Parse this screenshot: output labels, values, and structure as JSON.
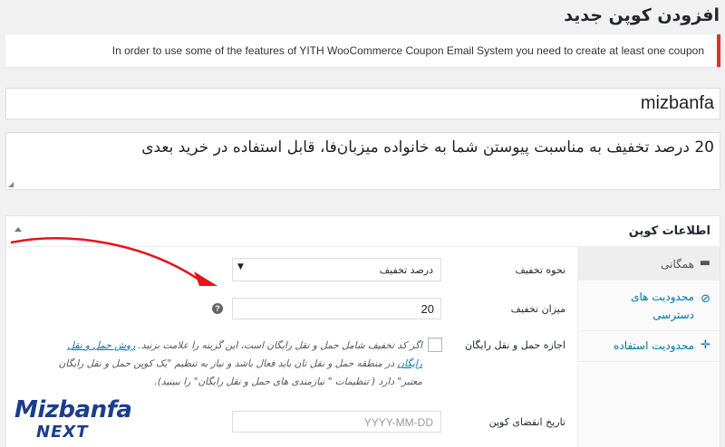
{
  "page_title": "افزودن کوپن جدید",
  "notice": {
    "text": "In order to use some of the features of YITH WooCommerce Coupon Email System you need to create at least one coupon",
    "border_color": "#dc3232"
  },
  "coupon_code": "mizbanfa",
  "description": "20 درصد تخفیف به مناسبت پیوستن شما به خانواده میزبان‌فا، قابل استفاده در خرید بعدی",
  "coupon_data": {
    "title": "اطلاعات کوپن",
    "tabs": [
      {
        "label": "همگانی",
        "icon": "ticket-icon",
        "active": true
      },
      {
        "label": "محدودیت های دسترسی",
        "icon": "restriction-icon",
        "active": false
      },
      {
        "label": "محدودیت استفاده",
        "icon": "plus-icon",
        "active": false
      }
    ],
    "fields": {
      "discount_type": {
        "label": "نحوه تخفیف",
        "value": "درصد تخفیف"
      },
      "amount": {
        "label": "میزان تخفیف",
        "value": "20",
        "help": "?"
      },
      "free_shipping": {
        "label": "اجازه حمل و نقل رایگان",
        "checked": false,
        "desc": "اگر کد تخفیف شامل حمل و نقل رایگان است، این گزینه را علامت بزنید.",
        "link_text": "روش حمل و نقل رایگان",
        "desc_after": "در منطقه حمل و نقل تان باید فعال باشد و نیاز به تنظیم \"یک کوپن حمل و نقل رایگان معتبر\" دارد ( تنظیمات \" نیازمندی های حمل و نقل رایگان\" را ببینید)."
      },
      "expiry_date": {
        "label": "تاریخ انقضای کوپن",
        "placeholder": "YYYY-MM-DD"
      }
    }
  },
  "logo": {
    "top": "Mizbanfa",
    "bottom": "NEXT",
    "color": "#1a3e8c"
  },
  "annotation_arrow_color": "#e3141b"
}
